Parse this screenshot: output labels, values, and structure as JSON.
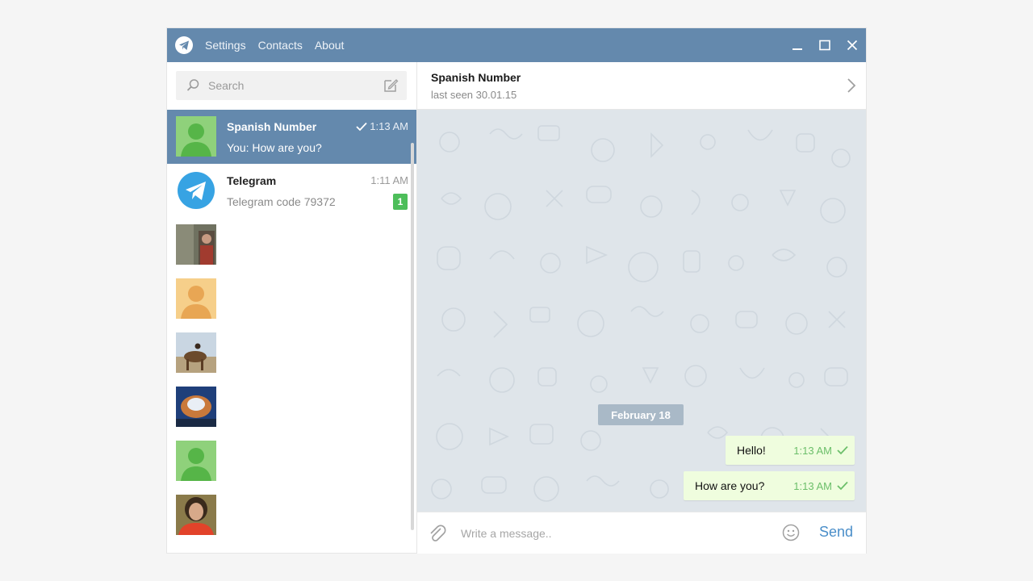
{
  "titlebar": {
    "menu": [
      "Settings",
      "Contacts",
      "About"
    ],
    "color": "#6489ad"
  },
  "search": {
    "placeholder": "Search"
  },
  "chats": [
    {
      "name": "Spanish Number",
      "time": "1:13 AM",
      "preview": "You: How are you?",
      "active": true,
      "avatar": "green-silhouette",
      "sent_check": true
    },
    {
      "name": "Telegram",
      "time": "1:11 AM",
      "preview": "Telegram code 79372",
      "badge": "1",
      "avatar": "telegram-logo"
    },
    {
      "name": "",
      "avatar": "photo-outdoor"
    },
    {
      "name": "",
      "avatar": "orange-silhouette"
    },
    {
      "name": "",
      "avatar": "photo-camel"
    },
    {
      "name": "",
      "avatar": "photo-bowl"
    },
    {
      "name": "",
      "avatar": "green-silhouette"
    },
    {
      "name": "",
      "avatar": "photo-person"
    }
  ],
  "header": {
    "peer_name": "Spanish Number",
    "peer_status": "last seen 30.01.15"
  },
  "conversation": {
    "date": "February 18",
    "messages": [
      {
        "text": "Hello!",
        "time": "1:13 AM"
      },
      {
        "text": "How are you?",
        "time": "1:13 AM"
      }
    ]
  },
  "composer": {
    "placeholder": "Write a message..",
    "send_label": "Send"
  },
  "colors": {
    "accent": "#6489ad",
    "outgoing_bubble": "#effdde",
    "badge": "#4dbe5a",
    "send": "#4a8ec9"
  }
}
